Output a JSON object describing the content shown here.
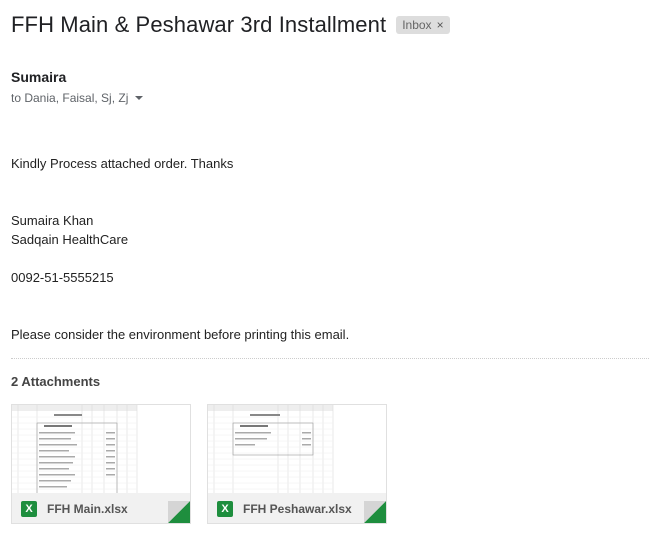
{
  "email": {
    "subject": "FFH Main & Peshawar 3rd Installment",
    "label": "Inbox",
    "label_remove": "×",
    "sender": "Sumaira",
    "recipients": "to Dania, Faisal, Sj, Zj",
    "body": {
      "line1": "Kindly Process attached order. Thanks",
      "sig_name": "Sumaira Khan",
      "sig_org": "Sadqain HealthCare",
      "sig_phone": "0092-51-5555215",
      "footer": "Please consider the environment before printing this email."
    }
  },
  "attachments": {
    "heading": "2 Attachments",
    "items": [
      {
        "name": "FFH Main.xlsx",
        "icon": "excel-icon",
        "icon_letter": "X"
      },
      {
        "name": "FFH Peshawar.xlsx",
        "icon": "excel-icon",
        "icon_letter": "X"
      }
    ]
  },
  "colors": {
    "excel_green": "#1e8e3e",
    "label_bg": "#dddddd"
  }
}
